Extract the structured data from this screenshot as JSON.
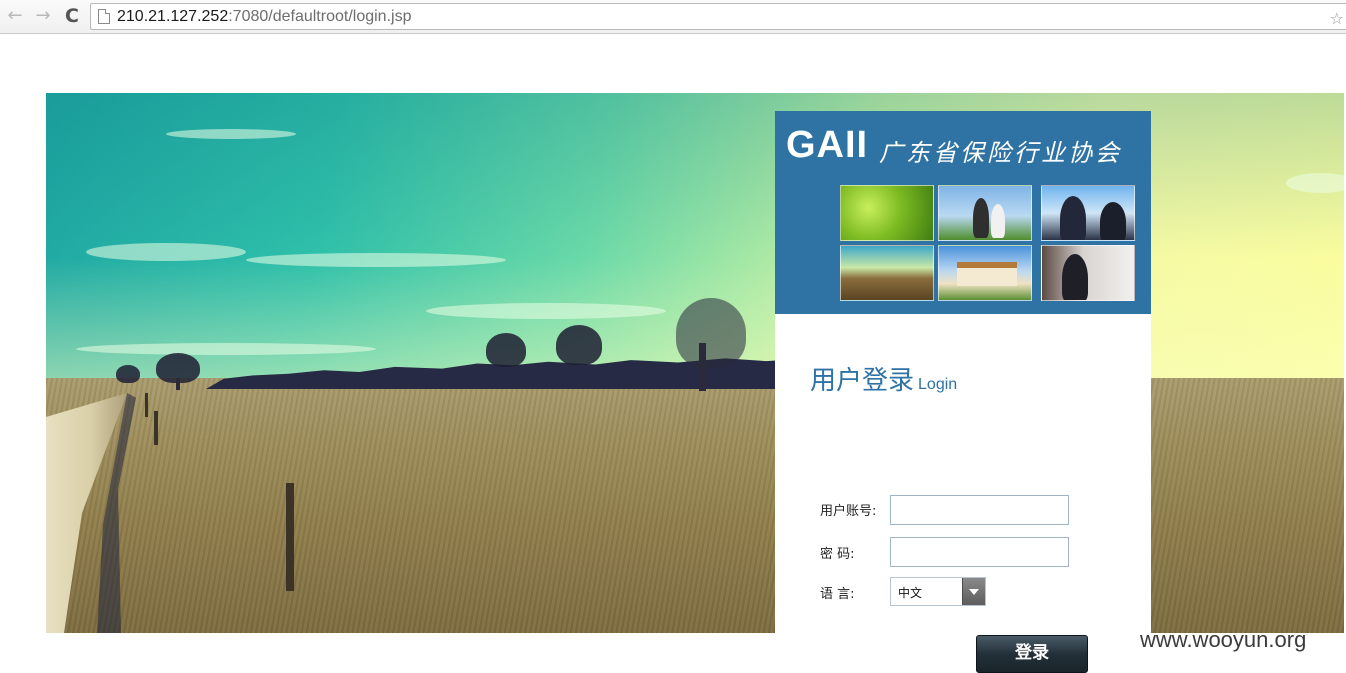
{
  "browser": {
    "url_host": "210.21.127.252",
    "url_rest": ":7080/defaultroot/login.jsp",
    "back_icon": "←",
    "forward_icon": "→",
    "reload_icon": "C",
    "star_icon": "☆"
  },
  "banner": {
    "logo": "GAII",
    "org_name": "广东省保险行业协会"
  },
  "login": {
    "title_cn": "用户登录",
    "title_en": "Login",
    "account_label": "用户账号:",
    "account_value": "",
    "password_label": "密 码:",
    "password_value": "",
    "language_label": "语 言:",
    "language_selected": "中文",
    "submit_label": "登录"
  },
  "watermark": "www.wooyun.org",
  "colors": {
    "banner_blue": "#2e73a4",
    "title_blue": "#2e73a4",
    "button_dark": "#233039"
  }
}
